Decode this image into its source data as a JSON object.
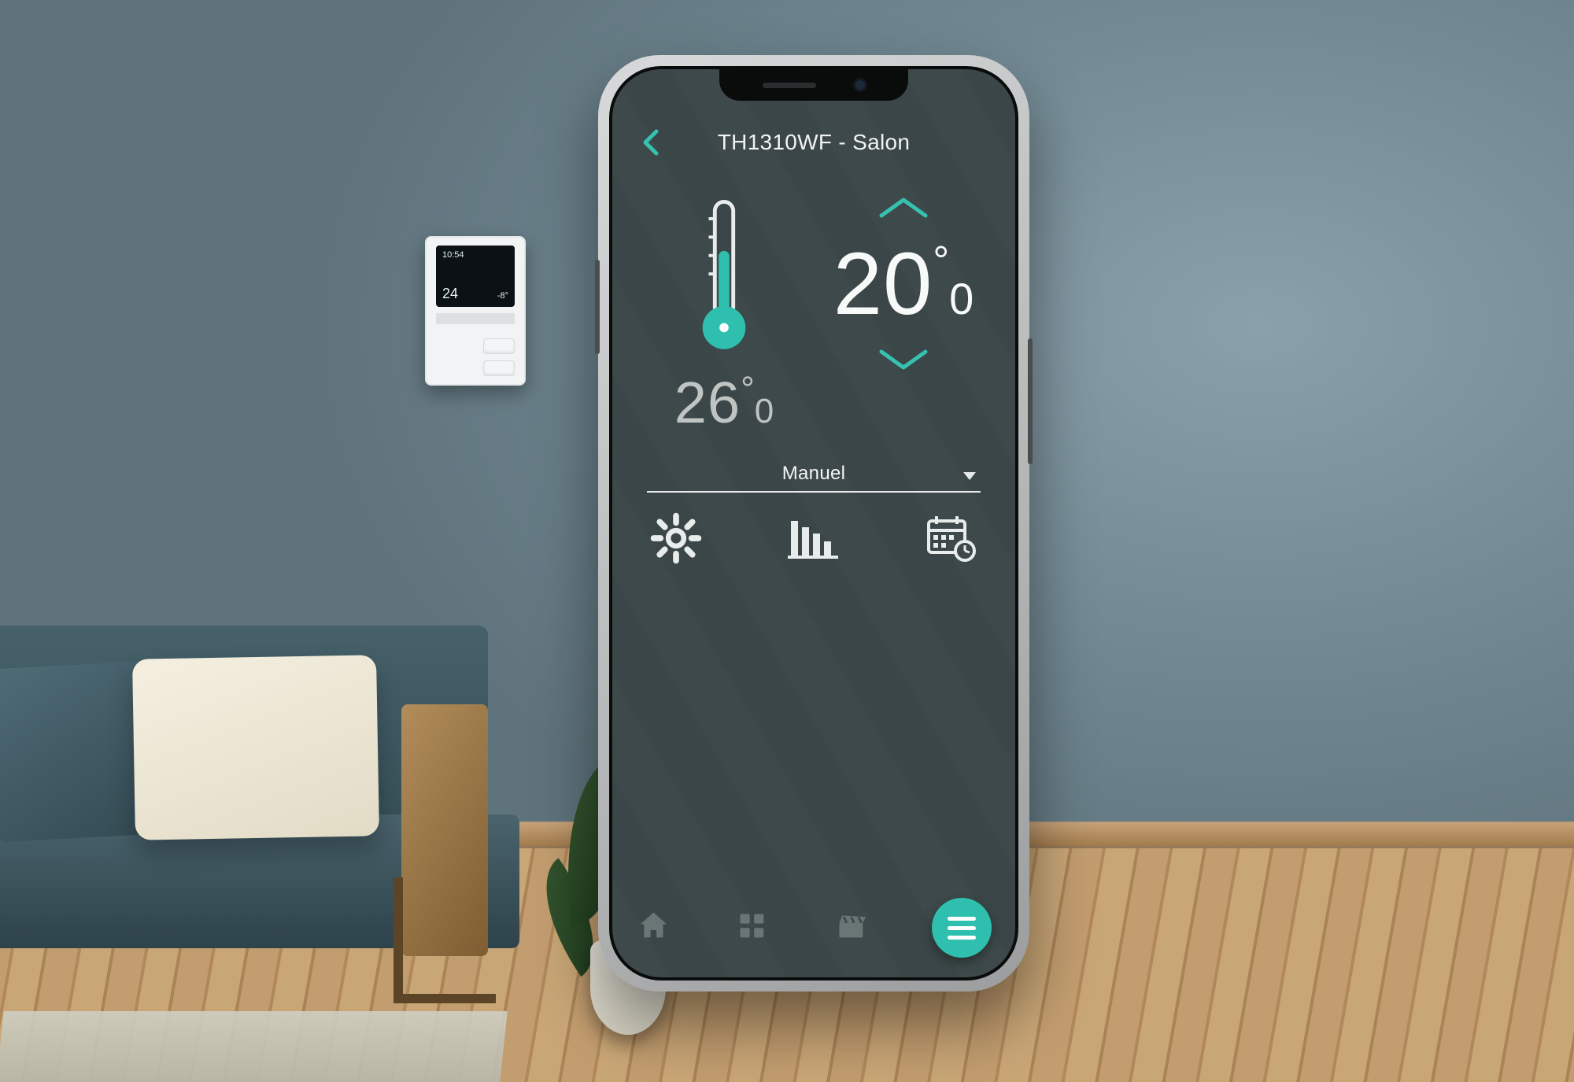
{
  "colors": {
    "accent": "#35c2b0",
    "screen_bg": "#3c4849",
    "text": "#f3f6f5",
    "muted": "#c0c5c4"
  },
  "header": {
    "title": "TH1310WF - Salon"
  },
  "temperature": {
    "current_whole": "26",
    "current_decimal": "0",
    "setpoint_whole": "20",
    "setpoint_decimal": "0",
    "degree_mark": "°"
  },
  "mode": {
    "label": "Manuel"
  },
  "actions": {
    "settings": "settings",
    "stats": "statistics",
    "schedule": "schedule"
  },
  "nav": {
    "home": "home",
    "dashboard": "dashboard",
    "scenes": "scenes",
    "menu": "menu"
  },
  "wall_device": {
    "time": "10:54",
    "room_temp": "24",
    "outside_temp": "-8°"
  }
}
